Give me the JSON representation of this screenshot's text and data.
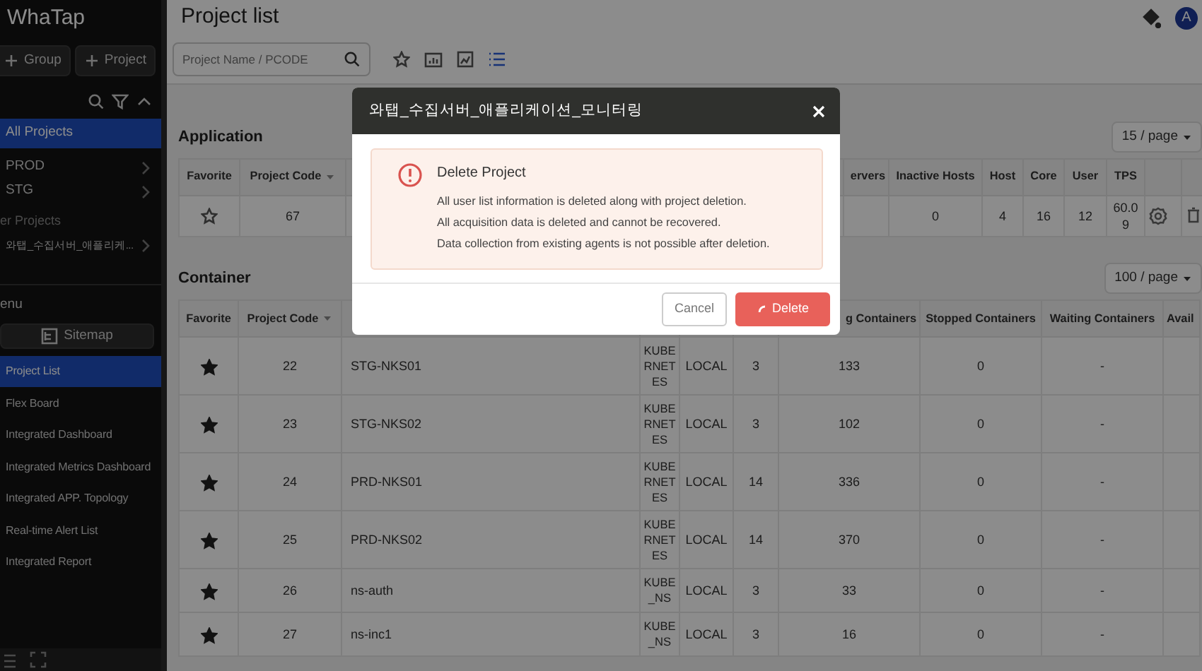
{
  "sidebar": {
    "logo": "WhaTap",
    "buttons": [
      {
        "label": "Group"
      },
      {
        "label": "Project"
      }
    ],
    "projects": [
      {
        "label": "All Projects",
        "selected": true,
        "expandable": false
      },
      {
        "label": "PROD",
        "selected": false,
        "expandable": true
      },
      {
        "label": "STG",
        "selected": false,
        "expandable": true
      }
    ],
    "group_label": "er Projects",
    "group_projects": [
      {
        "label": "와탭_수집서버_애플리케...",
        "selected": false,
        "expandable": true
      }
    ],
    "menu_label": "enu",
    "sitemap": "Sitemap",
    "menu": [
      {
        "label": "Project List",
        "selected": true
      },
      {
        "label": "Flex Board",
        "selected": false
      },
      {
        "label": "Integrated Dashboard",
        "selected": false
      },
      {
        "label": "Integrated Metrics Dashboard",
        "selected": false
      },
      {
        "label": "Integrated APP. Topology",
        "selected": false
      },
      {
        "label": "Real-time Alert List",
        "selected": false
      },
      {
        "label": "Integrated Report",
        "selected": false
      }
    ]
  },
  "header": {
    "title": "Project list",
    "avatar": "A"
  },
  "toolbar": {
    "placeholder": "Project Name / PCODE",
    "views": [
      {
        "kind": "star",
        "selected": false
      },
      {
        "kind": "bars",
        "selected": false
      },
      {
        "kind": "line",
        "selected": false
      },
      {
        "kind": "list",
        "selected": true
      }
    ]
  },
  "sections": [
    {
      "title": "Application",
      "page_size": "15 / page",
      "columns": [
        {
          "label": "Favorite"
        },
        {
          "label": "Project Code",
          "sorted": true
        },
        {},
        {
          "label": "ervers"
        },
        {
          "label": "Inactive Hosts"
        },
        {
          "label": "Host"
        },
        {
          "label": "Core"
        },
        {
          "label": "User"
        },
        {
          "label": "TPS"
        },
        {},
        {}
      ],
      "rows": [
        {
          "cells": [
            {
              "kind": "star",
              "checked": false
            },
            "67",
            null,
            null,
            "0",
            "4",
            "16",
            "12",
            "60.09",
            {
              "kind": "gear"
            },
            {
              "kind": "trash"
            }
          ]
        }
      ]
    },
    {
      "title": "Container",
      "page_size": "100 / page",
      "columns": [
        {
          "label": "Favorite"
        },
        {
          "label": "Project Code",
          "sorted": true
        },
        {},
        {},
        {},
        {},
        {
          "label": "g Containers"
        },
        {
          "label": "Stopped Containers"
        },
        {
          "label": "Waiting Containers"
        },
        {
          "label": "Avail"
        }
      ],
      "rows": [
        {
          "cells": [
            {
              "kind": "star",
              "checked": true
            },
            "22",
            "STG-NKS01",
            "KUBERNETES",
            "LOCAL",
            "3",
            "133",
            "0",
            "-",
            null
          ]
        },
        {
          "cells": [
            {
              "kind": "star",
              "checked": true
            },
            "23",
            "STG-NKS02",
            "KUBERNETES",
            "LOCAL",
            "3",
            "102",
            "0",
            "-",
            null
          ]
        },
        {
          "cells": [
            {
              "kind": "star",
              "checked": true
            },
            "24",
            "PRD-NKS01",
            "KUBERNETES",
            "LOCAL",
            "14",
            "336",
            "0",
            "-",
            null
          ]
        },
        {
          "cells": [
            {
              "kind": "star",
              "checked": true
            },
            "25",
            "PRD-NKS02",
            "KUBERNETES",
            "LOCAL",
            "14",
            "370",
            "0",
            "-",
            null
          ]
        },
        {
          "cells": [
            {
              "kind": "star",
              "checked": true
            },
            "26",
            "ns-auth",
            "KUBE_NS",
            "LOCAL",
            "3",
            "33",
            "0",
            "-",
            null
          ]
        },
        {
          "cells": [
            {
              "kind": "star",
              "checked": true
            },
            "27",
            "ns-inc1",
            "KUBE_NS",
            "LOCAL",
            "3",
            "16",
            "0",
            "-",
            null
          ]
        }
      ]
    }
  ],
  "dialog": {
    "title": "와탭_수집서버_애플리케이션_모니터링",
    "alert_title": "Delete Project",
    "lines": [
      "All user list information is deleted along with project deletion.",
      "All acquisition data is deleted and cannot be recovered.",
      "Data collection from existing agents is not possible after deletion."
    ],
    "buttons": [
      {
        "label": "Cancel",
        "kind": "secondary",
        "loading": false
      },
      {
        "label": "Delete",
        "kind": "danger",
        "loading": true
      }
    ]
  }
}
